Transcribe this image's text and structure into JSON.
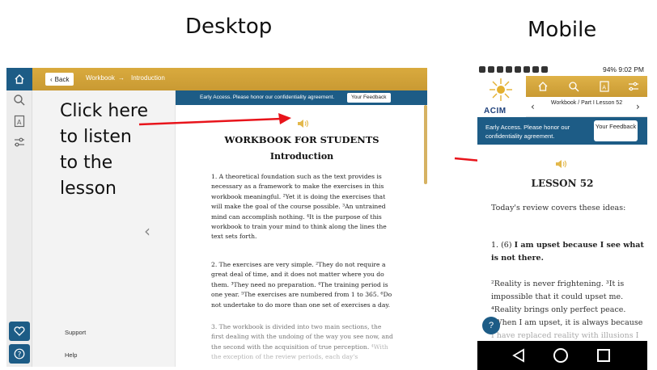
{
  "headings": {
    "desktop": "Desktop",
    "mobile": "Mobile"
  },
  "desktop": {
    "breadcrumb": {
      "back": "Back",
      "section": "Workbook",
      "arrow": "→",
      "page": "Introduction"
    },
    "callout_lines": [
      "Click here",
      "to listen",
      "to the",
      "lesson"
    ],
    "sidebar": {
      "support": "Support",
      "help": "Help"
    },
    "early_access": "Early Access. Please honor our confidentiality agreement.",
    "feedback_button": "Your Feedback",
    "title": "WORKBOOK FOR STUDENTS",
    "subtitle": "Introduction",
    "paragraphs": [
      {
        "num": "1.",
        "text": "A theoretical foundation such as the text provides is necessary as a framework to make the exercises in this workbook meaningful. ²Yet it is doing the exercises that will make the goal of the course possible. ³An untrained mind can accomplish nothing. ⁴It is the purpose of this workbook to train your mind to think along the lines the text sets forth."
      },
      {
        "num": "2.",
        "text": "The exercises are very simple. ²They do not require a great deal of time, and it does not matter where you do them. ³They need no preparation. ⁴The training period is one year. ⁵The exercises are numbered from 1 to 365. ⁶Do not undertake to do more than one set of exercises a day."
      },
      {
        "num": "3.",
        "text": "The workbook is divided into two main sections, the first dealing with the undoing of the way you see now, and the second with the acquisition of true perception.",
        "faded": "⁴With the exception of the review periods, each day's"
      }
    ]
  },
  "mobile": {
    "status_right": "94%  9:02 PM",
    "logo_text": "ACIM",
    "breadcrumb": "Workbook  /  Part I Lesson 52",
    "early_access": "Early Access. Please honor our confidentiality agreement.",
    "feedback_button": "Your Feedback",
    "lesson_title": "LESSON 52",
    "review_text": "Today's review covers these ideas:",
    "idea_num": "1. (6)",
    "idea_text": "I am upset because I see what is not there.",
    "body_text": "²Reality is never frightening. ³It is impossible that it could upset me. ⁴Reality brings only perfect peace. ⁵When I am upset, it is always because",
    "body_faded": "I have replaced reality with illusions I",
    "help_label": "?"
  },
  "colors": {
    "gold": "#d4a43a",
    "navy": "#1d5c86",
    "arrow": "#e8141b",
    "speaker": "#e3b84c"
  }
}
